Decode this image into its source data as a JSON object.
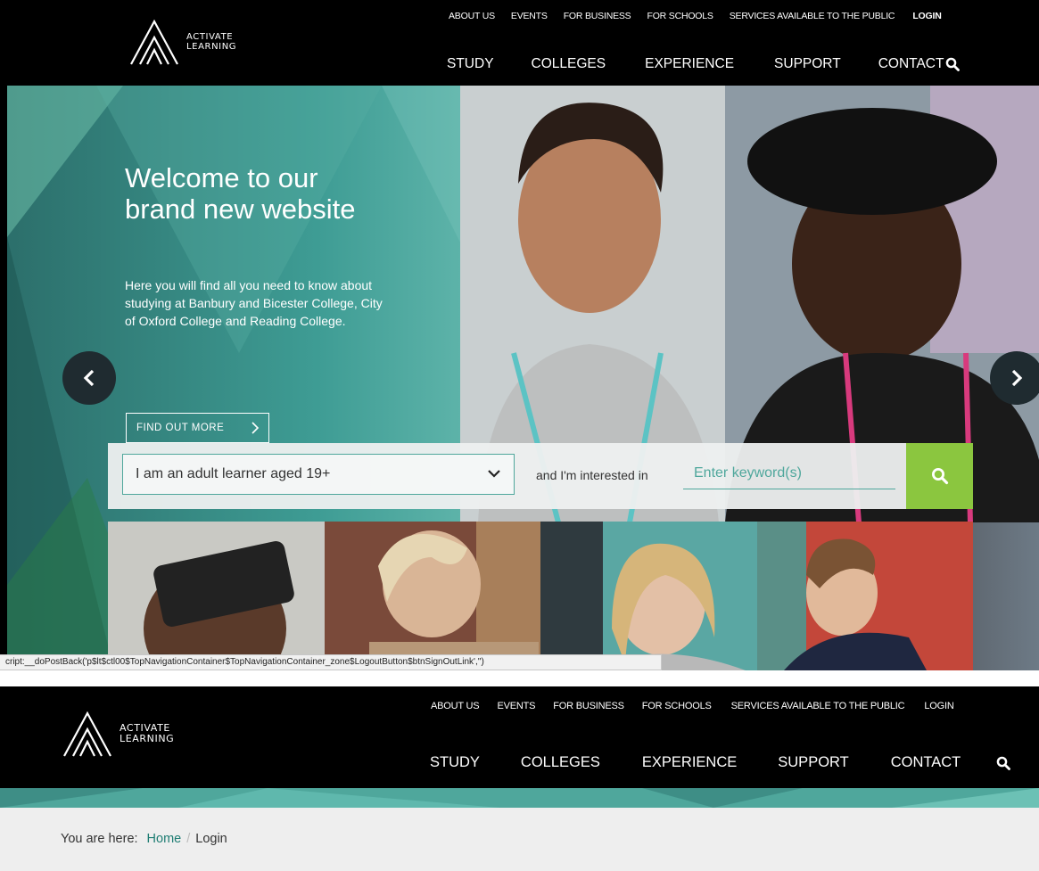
{
  "brand": {
    "line1": "ACTIVATE",
    "line2": "LEARNING"
  },
  "top_links": [
    "ABOUT US",
    "EVENTS",
    "FOR BUSINESS",
    "FOR SCHOOLS",
    "SERVICES AVAILABLE TO THE PUBLIC",
    "LOGIN"
  ],
  "main_nav": [
    "STUDY",
    "COLLEGES",
    "EXPERIENCE",
    "SUPPORT",
    "CONTACT"
  ],
  "hero": {
    "title": "Welcome to our brand new website",
    "subtitle": "Here you will find all you need to know about studying at Banbury and Bicester College, City of Oxford College and Reading College.",
    "cta": "FIND OUT MORE"
  },
  "search": {
    "learner_select": "I am an adult learner aged 19+",
    "connector": "and I'm interested in",
    "keyword_placeholder": "Enter keyword(s)"
  },
  "status_bar": "cript:__doPostBack('p$lt$ctl00$TopNavigationContainer$TopNavigationContainer_zone$LogoutButton$btnSignOutLink','')",
  "breadcrumb": {
    "prefix": "You are here:",
    "home": "Home",
    "separator": "/",
    "current": "Login"
  },
  "colors": {
    "teal": "#4fa79c",
    "search_green": "#8bc63f",
    "header_black": "#000000",
    "crumb_bg": "#eeeeee"
  },
  "icons": {
    "search": "search-icon",
    "prev": "chevron-left-icon",
    "next": "chevron-right-icon",
    "dropdown": "chevron-down-icon"
  }
}
